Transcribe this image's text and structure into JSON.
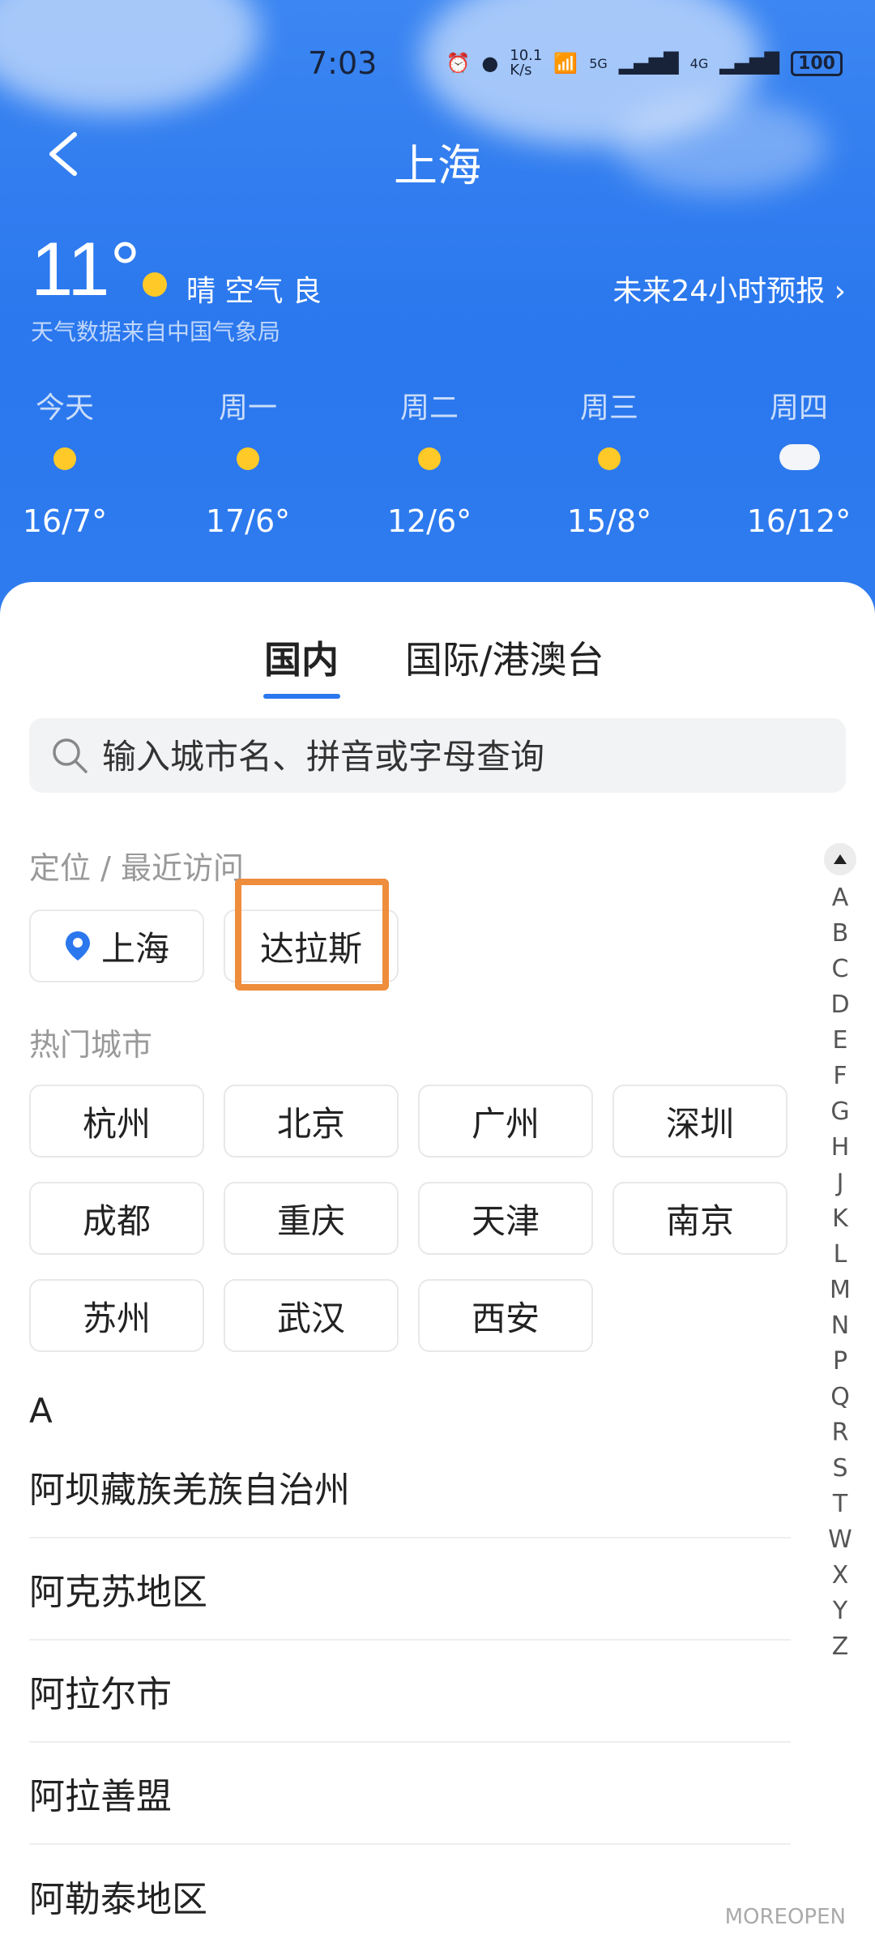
{
  "status_bar": {
    "time": "7:03",
    "net_speed": "10.1\nK/s",
    "signal1": "5G",
    "signal2": "4G",
    "battery": "100"
  },
  "header": {
    "city": "上海"
  },
  "current": {
    "temperature": "11°",
    "condition": "晴 空气 良",
    "source": "天气数据来自中国气象局",
    "forecast_link": "未来24小时预报 ›"
  },
  "week": [
    {
      "day": "今天",
      "range": "16/7°",
      "icon": "sun-icon"
    },
    {
      "day": "周一",
      "range": "17/6°",
      "icon": "sun-icon"
    },
    {
      "day": "周二",
      "range": "12/6°",
      "icon": "sun-icon"
    },
    {
      "day": "周三",
      "range": "15/8°",
      "icon": "sun-icon"
    },
    {
      "day": "周四",
      "range": "16/12°",
      "icon": "cloud-icon"
    }
  ],
  "tabs": [
    {
      "label": "国内",
      "active": true
    },
    {
      "label": "国际/港澳台",
      "active": false
    }
  ],
  "search": {
    "placeholder": "输入城市名、拼音或字母查询"
  },
  "recent": {
    "label": "定位 / 最近访问",
    "items": [
      "上海",
      "达拉斯"
    ]
  },
  "hot": {
    "label": "热门城市",
    "items": [
      "杭州",
      "北京",
      "广州",
      "深圳",
      "成都",
      "重庆",
      "天津",
      "南京",
      "苏州",
      "武汉",
      "西安"
    ]
  },
  "list": {
    "letter": "A",
    "items": [
      "阿坝藏族羌族自治州",
      "阿克苏地区",
      "阿拉尔市",
      "阿拉善盟",
      "阿勒泰地区"
    ]
  },
  "index_letters": [
    "A",
    "B",
    "C",
    "D",
    "E",
    "F",
    "G",
    "H",
    "J",
    "K",
    "L",
    "M",
    "N",
    "P",
    "Q",
    "R",
    "S",
    "T",
    "W",
    "X",
    "Y",
    "Z"
  ],
  "watermark": "MOREOPEN",
  "colors": {
    "accent": "#2a77ee",
    "highlight": "#ee8d3b",
    "sun": "#ffc928"
  }
}
